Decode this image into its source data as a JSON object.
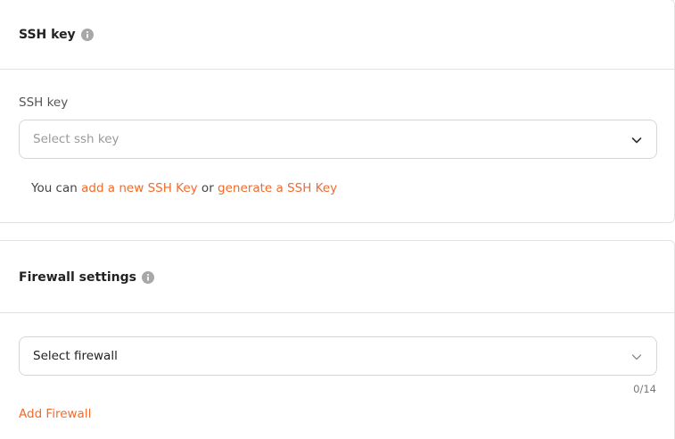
{
  "ssh_section": {
    "title": "SSH key",
    "field_label": "SSH key",
    "select": {
      "placeholder": "Select ssh key"
    },
    "helper": {
      "prefix": "You can ",
      "link_add": "add a new SSH Key",
      "middle": " or ",
      "link_generate": "generate a SSH Key"
    }
  },
  "firewall_section": {
    "title": "Firewall settings",
    "select": {
      "value": "Select firewall"
    },
    "counter": "0/14",
    "add_link": "Add Firewall"
  },
  "colors": {
    "accent": "#f26b2b",
    "info_icon": "#a8a8a8",
    "border": "#e3e3e3"
  },
  "icons": {
    "info": "info-icon",
    "chevron": "chevron-down-icon"
  }
}
